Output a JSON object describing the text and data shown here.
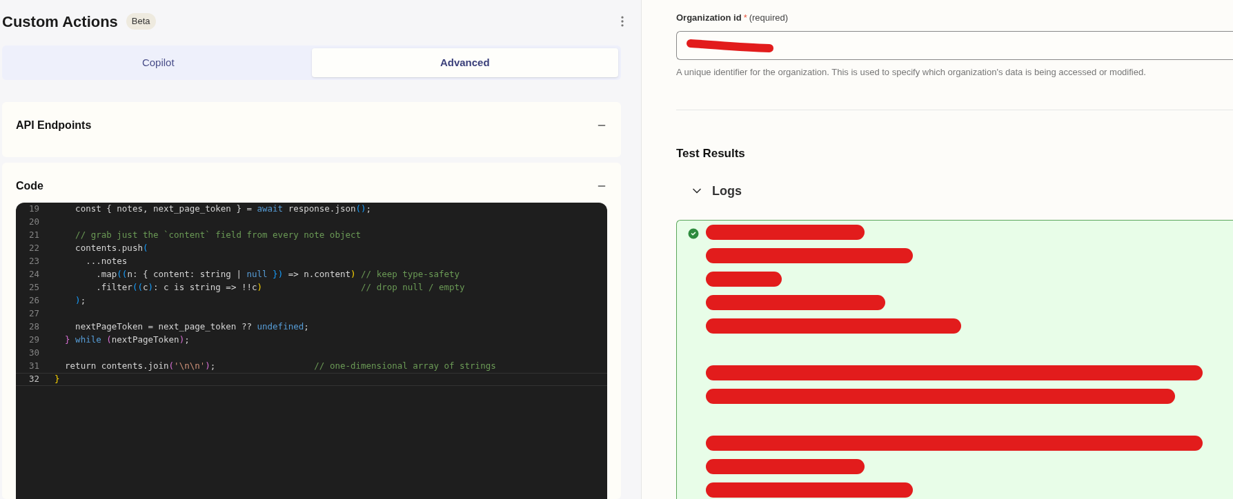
{
  "header": {
    "title": "Custom Actions",
    "badge": "Beta"
  },
  "tabs": [
    {
      "label": "Copilot",
      "selected": false
    },
    {
      "label": "Advanced",
      "selected": true
    }
  ],
  "sections": [
    {
      "title": "API Endpoints",
      "expanded": true
    },
    {
      "title": "Code",
      "expanded": true
    }
  ],
  "code": {
    "lines": [
      {
        "number": "19",
        "segments": [
          {
            "t": "    const { notes, next_page_token } = ",
            "kind": "plain"
          },
          {
            "t": "await",
            "kind": "keyword"
          },
          {
            "t": " response.json",
            "kind": "plain"
          },
          {
            "t": "()",
            "kind": "bracket"
          },
          {
            "t": ";",
            "kind": "plain"
          }
        ]
      },
      {
        "number": "20"
      },
      {
        "number": "21",
        "segments": [
          {
            "t": "    // grab just the `content` field from every note object",
            "kind": "comment"
          }
        ]
      },
      {
        "number": "22",
        "segments": [
          {
            "t": "    contents.push",
            "kind": "plain"
          },
          {
            "t": "(",
            "kind": "bracket"
          }
        ]
      },
      {
        "number": "23",
        "segments": [
          {
            "t": "      ...notes",
            "kind": "plain"
          }
        ]
      },
      {
        "number": "24",
        "segments": [
          {
            "t": "        .map",
            "kind": "plain"
          },
          {
            "t": "((",
            "kind": "bracket"
          },
          {
            "t": "n: { content: string | ",
            "kind": "plain"
          },
          {
            "t": "null",
            "kind": "keyword"
          },
          {
            "t": " })",
            "kind": "bracket"
          },
          {
            "t": " => n.content",
            "kind": "plain"
          },
          {
            "t": ")",
            "kind": "paren"
          },
          {
            "t": " // keep type-safety",
            "kind": "comment"
          }
        ]
      },
      {
        "number": "25",
        "segments": [
          {
            "t": "        .filter",
            "kind": "plain"
          },
          {
            "t": "((",
            "kind": "bracket"
          },
          {
            "t": "c",
            "kind": "plain"
          },
          {
            "t": ")",
            "kind": "bracket"
          },
          {
            "t": ": c is string => !!c",
            "kind": "plain"
          },
          {
            "t": ")",
            "kind": "paren"
          },
          {
            "t": "                   // drop null / empty",
            "kind": "comment"
          }
        ]
      },
      {
        "number": "26",
        "segments": [
          {
            "t": "    )",
            "kind": "bracket"
          },
          {
            "t": ";",
            "kind": "plain"
          }
        ]
      },
      {
        "number": "27"
      },
      {
        "number": "28",
        "segments": [
          {
            "t": "    nextPageToken = next_page_token ?? ",
            "kind": "plain"
          },
          {
            "t": "undefined",
            "kind": "keyword"
          },
          {
            "t": ";",
            "kind": "plain"
          }
        ]
      },
      {
        "number": "29",
        "segments": [
          {
            "t": "  }",
            "kind": "magenta"
          },
          {
            "t": " while",
            "kind": "keyword"
          },
          {
            "t": " (",
            "kind": "magenta"
          },
          {
            "t": "nextPageToken",
            "kind": "plain"
          },
          {
            "t": ")",
            "kind": "magenta"
          },
          {
            "t": ";",
            "kind": "plain"
          }
        ]
      },
      {
        "number": "30"
      },
      {
        "number": "31",
        "segments": [
          {
            "t": "  return contents.join",
            "kind": "plain"
          },
          {
            "t": "(",
            "kind": "magenta"
          },
          {
            "t": "'\\n\\n'",
            "kind": "string"
          },
          {
            "t": ")",
            "kind": "magenta"
          },
          {
            "t": ";",
            "kind": "plain"
          },
          {
            "t": "                   // one-dimensional array of strings",
            "kind": "comment"
          }
        ]
      },
      {
        "number": "32",
        "segments": [
          {
            "t": "}",
            "kind": "paren"
          }
        ],
        "current": true
      }
    ]
  },
  "organization_field": {
    "label": "Organization id",
    "required_mark": "*",
    "required_note": "(required)",
    "help": "A unique identifier for the organization. This is used to specify which organization's data is being accessed or modified."
  },
  "test_results": {
    "title": "Test Results",
    "logs": {
      "label": "Logs",
      "expanded": true
    },
    "success": true,
    "log_entries": [
      {
        "kind": "redacted"
      },
      {
        "kind": "redacted"
      },
      {
        "kind": "redacted"
      },
      {
        "kind": "redacted"
      },
      {
        "kind": "redacted"
      },
      {
        "kind": "gap"
      },
      {
        "kind": "redacted"
      },
      {
        "kind": "redacted"
      },
      {
        "kind": "gap"
      },
      {
        "kind": "redacted"
      },
      {
        "kind": "redacted"
      },
      {
        "kind": "redacted"
      }
    ]
  }
}
